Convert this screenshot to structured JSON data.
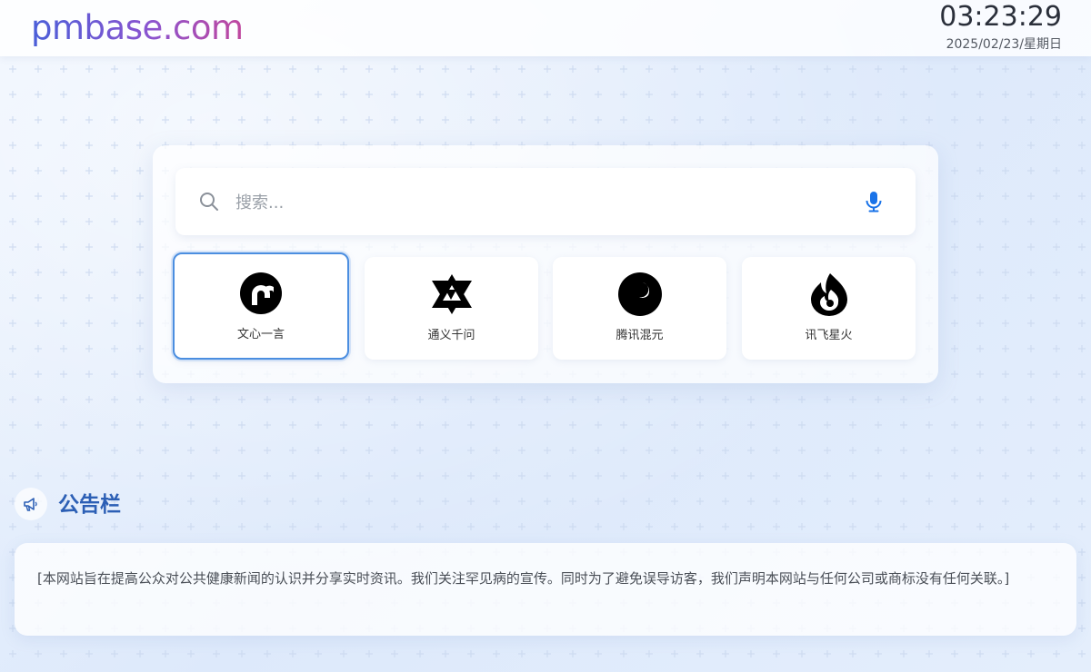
{
  "header": {
    "logo": "pmbase.com",
    "time": "03:23:29",
    "date": "2025/02/23/星期日"
  },
  "search": {
    "placeholder": "搜索..."
  },
  "ai_tools": [
    {
      "label": "文心一言",
      "icon": "wenxin-icon",
      "active": true
    },
    {
      "label": "通义千问",
      "icon": "tongyi-icon",
      "active": false
    },
    {
      "label": "腾讯混元",
      "icon": "hunyuan-icon",
      "active": false
    },
    {
      "label": "讯飞星火",
      "icon": "xinghuo-icon",
      "active": false
    }
  ],
  "notice": {
    "title": "公告栏",
    "text": "[本网站旨在提高公众对公共健康新闻的认识并分享实时资讯。我们关注罕见病的宣传。同时为了避免误导访客，我们声明本网站与任何公司或商标没有任何关联。]"
  },
  "colors": {
    "accent": "#2c5fb5",
    "mic": "#1a73e8",
    "active_border": "#4b8ee0"
  }
}
